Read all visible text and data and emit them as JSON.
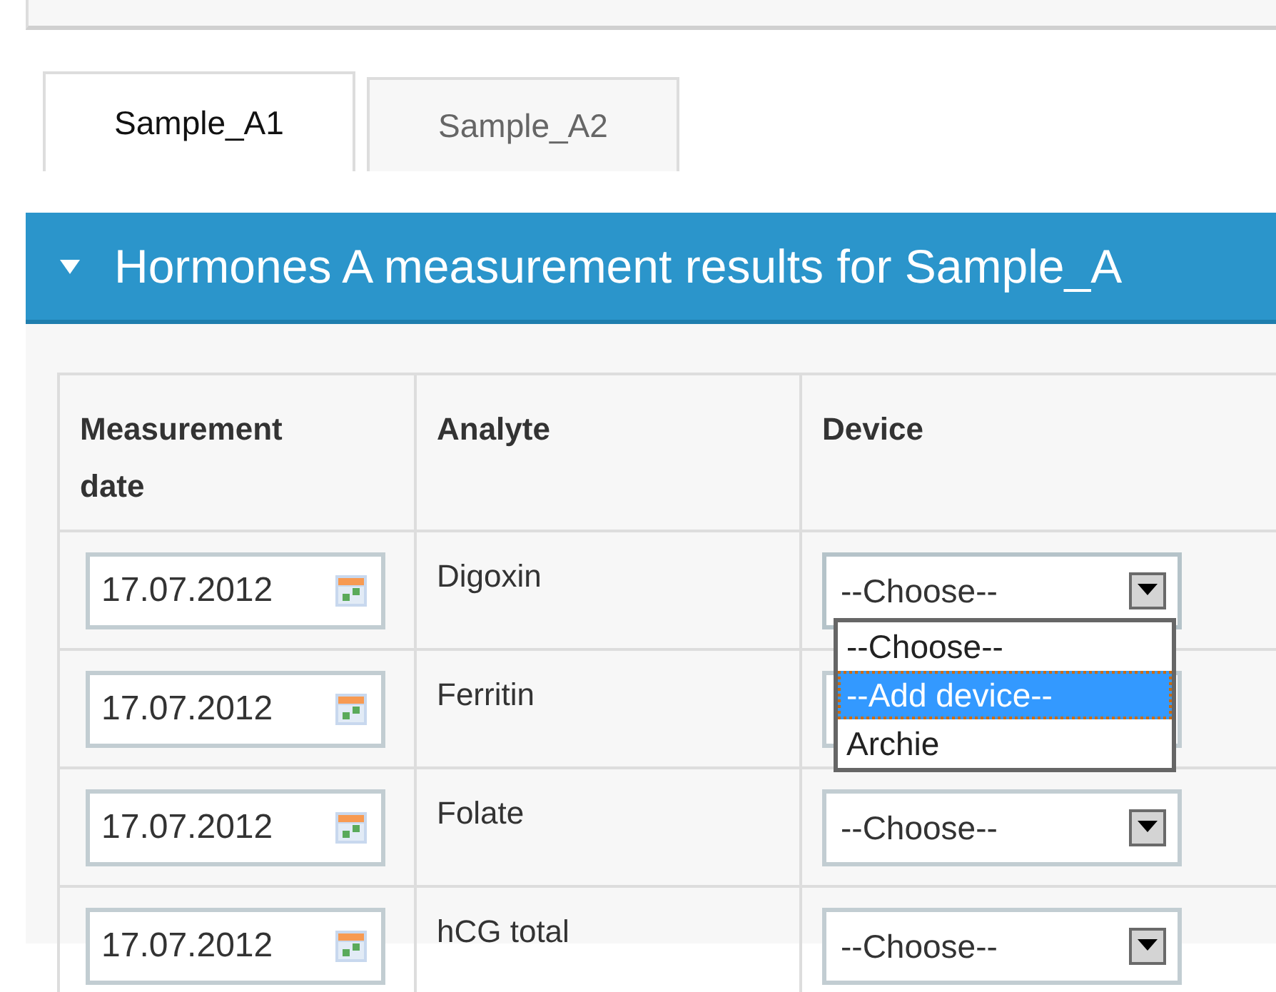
{
  "tabs": [
    {
      "label": "Sample_A1",
      "selected": true
    },
    {
      "label": "Sample_A2",
      "selected": false
    }
  ],
  "panel": {
    "title": "Hormones A measurement results for Sample_A",
    "expanded": true
  },
  "table": {
    "columns": [
      "Measurement date",
      "Analyte",
      "Device"
    ],
    "rows": [
      {
        "date": "17.07.2012",
        "analyte": "Digoxin",
        "device": "--Choose--",
        "open": true,
        "options": [
          {
            "label": "--Choose--",
            "selected": false
          },
          {
            "label": "--Add device--",
            "selected": true
          },
          {
            "label": "Archie",
            "selected": false
          }
        ]
      },
      {
        "date": "17.07.2012",
        "analyte": "Ferritin",
        "open": false
      },
      {
        "date": "17.07.2012",
        "analyte": "Folate",
        "device": "--Choose--",
        "open": false
      },
      {
        "date": "17.07.2012",
        "analyte": "hCG total",
        "device": "--Choose--",
        "open": false
      }
    ]
  }
}
